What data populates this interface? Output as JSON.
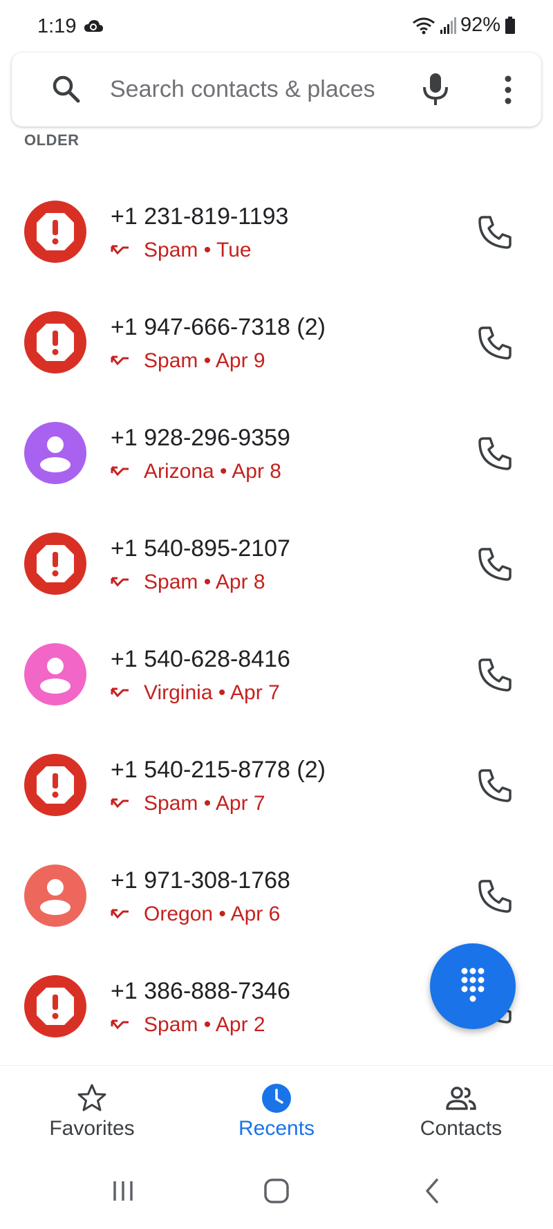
{
  "status_bar": {
    "time": "1:19",
    "battery": "92%"
  },
  "search": {
    "placeholder": "Search contacts & places"
  },
  "section": {
    "header": "OLDER"
  },
  "calls": [
    {
      "number": "+1 231-819-1193",
      "count": "",
      "label": "Spam",
      "date": "Tue",
      "avatar": "spam",
      "color": "#d93025"
    },
    {
      "number": "+1 947-666-7318",
      "count": "(2)",
      "label": "Spam",
      "date": "Apr 9",
      "avatar": "spam",
      "color": "#d93025"
    },
    {
      "number": "+1 928-296-9359",
      "count": "",
      "label": "Arizona",
      "date": "Apr 8",
      "avatar": "person",
      "color": "#a962f0"
    },
    {
      "number": "+1 540-895-2107",
      "count": "",
      "label": "Spam",
      "date": "Apr 8",
      "avatar": "spam",
      "color": "#d93025"
    },
    {
      "number": "+1 540-628-8416",
      "count": "",
      "label": "Virginia",
      "date": "Apr 7",
      "avatar": "person",
      "color": "#f266c8"
    },
    {
      "number": "+1 540-215-8778",
      "count": "(2)",
      "label": "Spam",
      "date": "Apr 7",
      "avatar": "spam",
      "color": "#d93025"
    },
    {
      "number": "+1 971-308-1768",
      "count": "",
      "label": "Oregon",
      "date": "Apr 6",
      "avatar": "person",
      "color": "#ee675c"
    },
    {
      "number": "+1 386-888-7346",
      "count": "",
      "label": "Spam",
      "date": "Apr 2",
      "avatar": "spam",
      "color": "#d93025"
    }
  ],
  "nav": {
    "favorites": "Favorites",
    "recents": "Recents",
    "contacts": "Contacts"
  },
  "colors": {
    "accent": "#1a73e8",
    "missed": "#c5221f",
    "spam": "#d93025"
  },
  "icons": {
    "call": "phone-icon",
    "dialpad": "dialpad-icon",
    "missed": "missed-call-icon"
  }
}
